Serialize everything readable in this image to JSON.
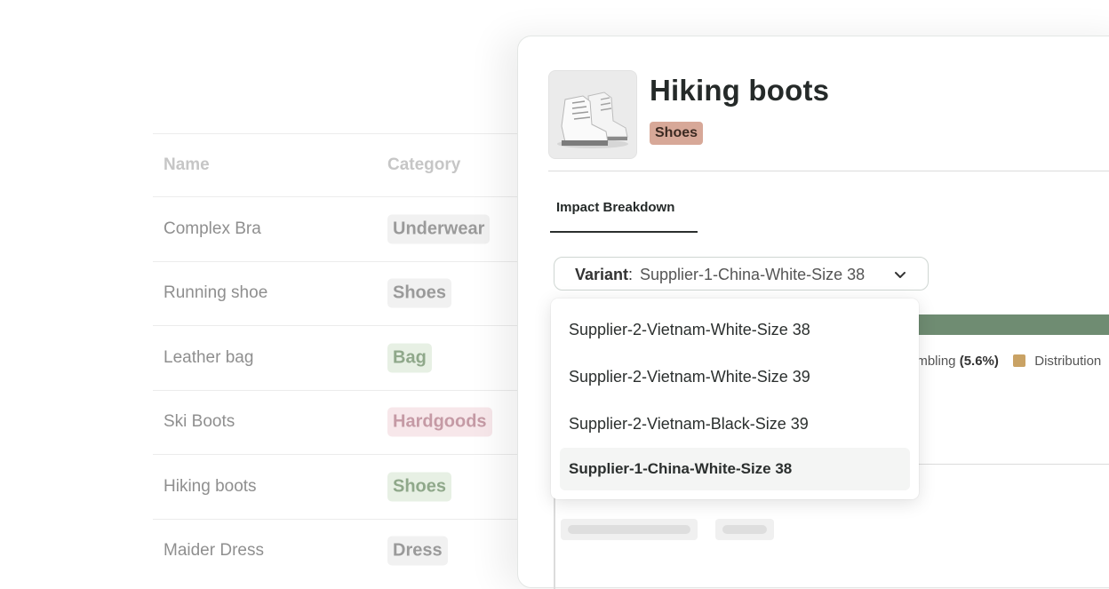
{
  "table": {
    "headers": {
      "name": "Name",
      "category": "Category"
    },
    "rows": [
      {
        "name": "Complex Bra",
        "category": "Underwear"
      },
      {
        "name": "Running shoe",
        "category": "Shoes"
      },
      {
        "name": "Leather bag",
        "category": "Bag"
      },
      {
        "name": "Ski Boots",
        "category": "Hardgoods"
      },
      {
        "name": "Hiking boots",
        "category": "Shoes"
      },
      {
        "name": "Maider Dress",
        "category": "Dress"
      }
    ]
  },
  "product": {
    "title": "Hiking boots",
    "category": "Shoes"
  },
  "tabs": {
    "active": "Impact Breakdown"
  },
  "variant": {
    "label": "Variant",
    "separator": ":",
    "value": "Supplier-1-China-White-Size 38",
    "options": [
      "Supplier-2-Vietnam-White-Size 38",
      "Supplier-2-Vietnam-White-Size 39",
      "Supplier-2-Vietnam-Black-Size 39",
      "Supplier-1-China-White-Size 38"
    ]
  },
  "legend": {
    "item1_label": "embling",
    "item1_value": "(5.6%)",
    "item2_label": "Distribution"
  },
  "colors": {
    "impact_bar": "#6f8c72",
    "category_badge": "#d7a898",
    "distribution_swatch": "#c9a264"
  },
  "icons": [
    "chevron-down-icon",
    "boot-image"
  ]
}
